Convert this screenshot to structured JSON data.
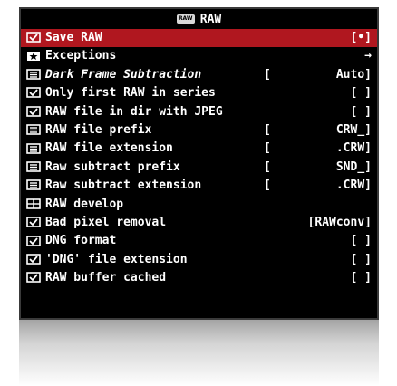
{
  "title": "RAW",
  "camera_badge": "RAW",
  "colors": {
    "selected_row": "#b0171f",
    "background": "#000000",
    "text": "#ffffff"
  },
  "rows": [
    {
      "icon": "checkbox-icon",
      "label": "Save RAW",
      "bracket_open": "",
      "value": "[•]",
      "selected": true,
      "italic": false
    },
    {
      "icon": "star-icon",
      "label": "Exceptions",
      "bracket_open": "",
      "value": "→",
      "selected": false,
      "italic": false
    },
    {
      "icon": "list-icon",
      "label": "Dark Frame Subtraction",
      "bracket_open": "[",
      "value": "Auto]",
      "selected": false,
      "italic": true
    },
    {
      "icon": "checkbox-icon",
      "label": "Only first RAW in series",
      "bracket_open": "",
      "value": "[ ]",
      "selected": false,
      "italic": false
    },
    {
      "icon": "checkbox-icon",
      "label": "RAW file in dir with JPEG",
      "bracket_open": "",
      "value": "[ ]",
      "selected": false,
      "italic": false
    },
    {
      "icon": "list-icon",
      "label": "RAW file prefix",
      "bracket_open": "[",
      "value": "CRW_]",
      "selected": false,
      "italic": false
    },
    {
      "icon": "list-icon",
      "label": "RAW file extension",
      "bracket_open": "[",
      "value": ".CRW]",
      "selected": false,
      "italic": false
    },
    {
      "icon": "list-icon",
      "label": "Raw subtract prefix",
      "bracket_open": "[",
      "value": "SND_]",
      "selected": false,
      "italic": false
    },
    {
      "icon": "list-icon",
      "label": "Raw subtract extension",
      "bracket_open": "[",
      "value": ".CRW]",
      "selected": false,
      "italic": false
    },
    {
      "icon": "grid-icon",
      "label": "RAW develop",
      "bracket_open": "",
      "value": "",
      "selected": false,
      "italic": false
    },
    {
      "icon": "checkbox-icon",
      "label": "Bad pixel removal",
      "bracket_open": "",
      "value": "[RAWconv]",
      "selected": false,
      "italic": false
    },
    {
      "icon": "checkbox-icon",
      "label": "DNG format",
      "bracket_open": "",
      "value": "[ ]",
      "selected": false,
      "italic": false
    },
    {
      "icon": "checkbox-icon",
      "label": "'DNG' file extension",
      "bracket_open": "",
      "value": "[ ]",
      "selected": false,
      "italic": false
    },
    {
      "icon": "checkbox-icon",
      "label": "RAW buffer cached",
      "bracket_open": "",
      "value": "[ ]",
      "selected": false,
      "italic": false
    }
  ]
}
